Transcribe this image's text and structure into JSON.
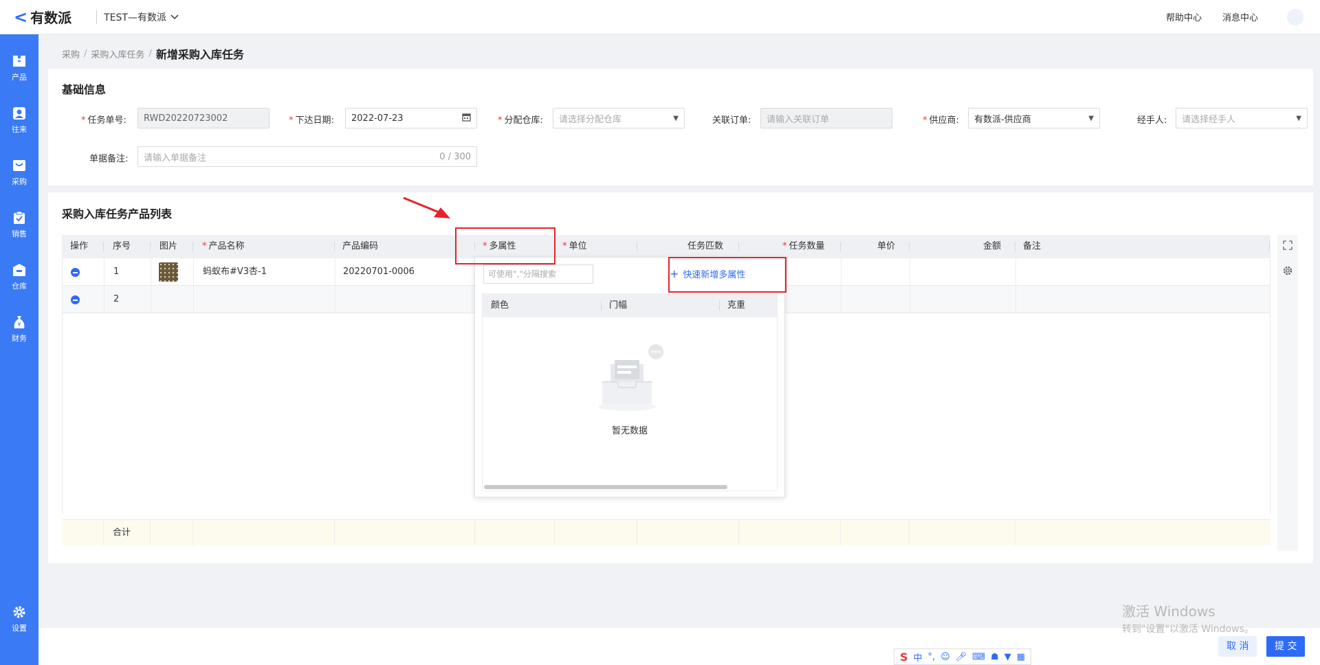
{
  "topbar": {
    "logo_text": "有数派",
    "org_name": "TEST—有数派",
    "help_link": "帮助中心",
    "message_link": "消息中心"
  },
  "sidebar": {
    "items": [
      {
        "label": "产品",
        "icon": "box-icon"
      },
      {
        "label": "往来",
        "icon": "contacts-icon"
      },
      {
        "label": "采购",
        "icon": "cart-icon"
      },
      {
        "label": "销售",
        "icon": "clipboard-icon"
      },
      {
        "label": "仓库",
        "icon": "warehouse-icon"
      },
      {
        "label": "财务",
        "icon": "money-bag-icon"
      }
    ],
    "settings_label": "设置",
    "active_color": "#ffffff",
    "bg_color": "#3a7af5"
  },
  "breadcrumb": {
    "level1": "采购",
    "level2": "采购入库任务",
    "current": "新增采购入库任务"
  },
  "basic_info": {
    "title": "基础信息",
    "task_no": {
      "label": "任务单号:",
      "value": "RWD20220723002"
    },
    "issue_date": {
      "label": "下达日期:",
      "value": "2022-07-23"
    },
    "warehouse": {
      "label": "分配仓库:",
      "placeholder": "请选择分配仓库"
    },
    "related_order": {
      "label": "关联订单:",
      "placeholder": "请输入关联订单"
    },
    "supplier": {
      "label": "供应商:",
      "value": "有数派-供应商"
    },
    "handler": {
      "label": "经手人:",
      "placeholder": "请选择经手人"
    },
    "remark": {
      "label": "单据备注:",
      "placeholder": "请输入单据备注",
      "counter": "0 / 300"
    }
  },
  "product_list": {
    "title": "采购入库任务产品列表",
    "columns": {
      "op": "操作",
      "seq": "序号",
      "image": "图片",
      "name": "产品名称",
      "code": "产品编码",
      "attrs": "多属性",
      "unit": "单位",
      "match": "任务匹数",
      "qty": "任务数量",
      "price": "单价",
      "amount": "金额",
      "note": "备注"
    },
    "rows": [
      {
        "seq": "1",
        "name": "蚂蚁布#V3杏-1",
        "code": "20220701-0006"
      },
      {
        "seq": "2",
        "name": "",
        "code": ""
      }
    ],
    "sum_label": "合计"
  },
  "attr_popover": {
    "search_placeholder": "可使用\",\"分隔搜索",
    "quick_add": "快速新增多属性",
    "columns": [
      "颜色",
      "门幅",
      "克重"
    ],
    "empty_text": "暂无数据"
  },
  "footer": {
    "cancel": "取 消",
    "submit": "提 交"
  },
  "watermark": {
    "line1": "激活 Windows",
    "line2": "转到\"设置\"以激活 Windows。"
  },
  "ime": {
    "logo": "S",
    "mode": "中",
    "punct": "°,"
  },
  "colors": {
    "primary": "#2d6bf6",
    "required": "#e33333",
    "highlight_box": "#e7212a"
  }
}
